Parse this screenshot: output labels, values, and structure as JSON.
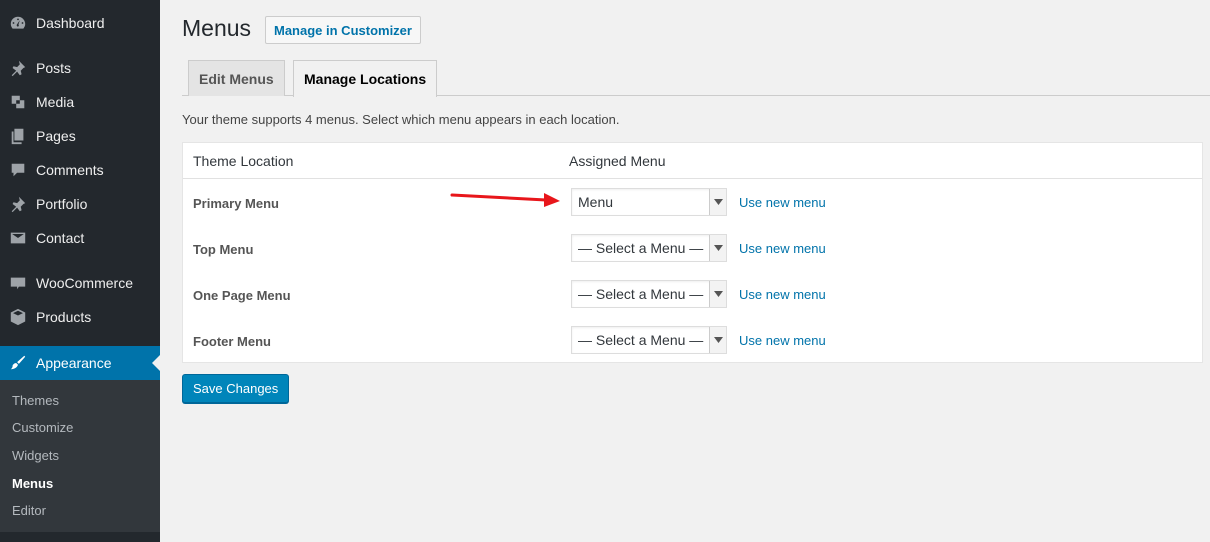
{
  "sidebar": {
    "items": [
      {
        "label": "Dashboard",
        "icon": "dashboard-icon"
      },
      {
        "label": "Posts",
        "icon": "pin-icon"
      },
      {
        "label": "Media",
        "icon": "media-icon"
      },
      {
        "label": "Pages",
        "icon": "pages-icon"
      },
      {
        "label": "Comments",
        "icon": "comments-icon"
      },
      {
        "label": "Portfolio",
        "icon": "pin-icon"
      },
      {
        "label": "Contact",
        "icon": "envelope-icon"
      },
      {
        "label": "WooCommerce",
        "icon": "woocommerce-icon"
      },
      {
        "label": "Products",
        "icon": "box-icon"
      },
      {
        "label": "Appearance",
        "icon": "paintbrush-icon"
      }
    ],
    "submenu": [
      "Themes",
      "Customize",
      "Widgets",
      "Menus",
      "Editor"
    ]
  },
  "header": {
    "title": "Menus",
    "action": "Manage in Customizer"
  },
  "tabs": [
    "Edit Menus",
    "Manage Locations"
  ],
  "intro": "Your theme supports 4 menus. Select which menu appears in each location.",
  "table": {
    "col_location": "Theme Location",
    "col_menu": "Assigned Menu",
    "rows": [
      {
        "location": "Primary Menu",
        "selected": "Menu",
        "link": "Use new menu"
      },
      {
        "location": "Top Menu",
        "selected": "— Select a Menu —",
        "link": "Use new menu"
      },
      {
        "location": "One Page Menu",
        "selected": "— Select a Menu —",
        "link": "Use new menu"
      },
      {
        "location": "Footer Menu",
        "selected": "— Select a Menu —",
        "link": "Use new menu"
      }
    ]
  },
  "save_label": "Save Changes",
  "colors": {
    "sidebar_bg": "#23282d",
    "accent": "#0073aa",
    "arrow": "#e8161b"
  }
}
